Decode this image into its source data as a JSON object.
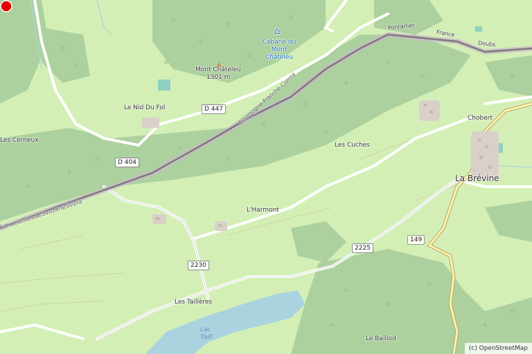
{
  "map": {
    "places": {
      "cabane": "Cabane du Mont Châteleu",
      "mont_chateleu": "Mont Châteleu",
      "mont_chateleu_ele": "1301 m",
      "le_nid_du_fol": "Le Nid Du Fol",
      "les_cerneux": "Les Cerneux",
      "les_cuches": "Les Cuches",
      "chobert": "Chobert",
      "la_brevine": "La Brévine",
      "l_harmont": "L'Harmont",
      "les_taillieres": "Les Taillères",
      "le_baillod": "Le Baillod",
      "lac": "Lac",
      "lac_partial": "Taill",
      "pontarlier": "Pontarlier",
      "france": "France",
      "doubs": "Doubs"
    },
    "roads": {
      "d447": "D 447",
      "d404": "D 404",
      "r2230": "2230",
      "r2225": "2225",
      "r149": "149"
    },
    "borders": {
      "region_fr": "Bourgogne-Franche-Comté",
      "country_ch": "Schweiz/Suisse/Svizzera/Svizra"
    },
    "attribution": "(c) OpenStreetMap",
    "colors": {
      "meadow": "#d3efb6",
      "forest": "#add19e",
      "water": "#aad3df",
      "border": "#8b8b8b",
      "marker": "#e60000"
    }
  }
}
